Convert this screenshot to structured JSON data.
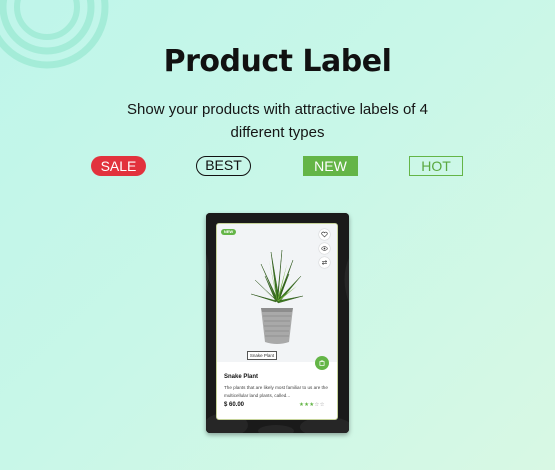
{
  "header": {
    "title": "Product Label",
    "subtitle": "Show your products with attractive labels of 4 different types"
  },
  "labels": [
    {
      "text": "SALE",
      "style": "filled-pill",
      "color": "#e2323d"
    },
    {
      "text": "BEST",
      "style": "outline-pill",
      "color": "#111111"
    },
    {
      "text": "NEW",
      "style": "filled-rect",
      "color": "#64b547"
    },
    {
      "text": "HOT",
      "style": "outline-rect",
      "color": "#64b547"
    }
  ],
  "product_card": {
    "badge": "NEW",
    "name_tag": "Snake Plant",
    "name": "Snake Plant",
    "description": "The plants that are likely most familiar to us are the multicellular land plants, called...",
    "price": "$ 60.00",
    "rating": 3,
    "rating_max": 5,
    "actions": [
      "heart-icon",
      "eye-icon",
      "compare-icon"
    ],
    "cart_icon": "cart-icon"
  },
  "colors": {
    "accent": "#64b547",
    "sale": "#e2323d",
    "background": "#c8f7e8"
  }
}
